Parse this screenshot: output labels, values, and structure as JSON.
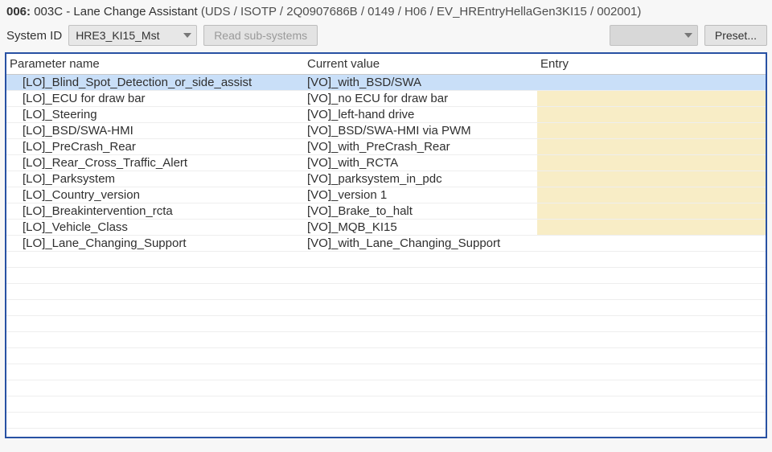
{
  "header": {
    "prefix": "006:",
    "title": "003C - Lane Change Assistant",
    "meta": "(UDS / ISOTP / 2Q0907686B / 0149 / H06 / EV_HREntryHellaGen3KI15 / 002001)"
  },
  "toolbar": {
    "system_label": "System ID",
    "system_value": "HRE3_KI15_Mst",
    "read_subsystems": "Read sub-systems",
    "dropdown2_value": "",
    "preset": "Preset..."
  },
  "columns": {
    "param": "Parameter name",
    "value": "Current value",
    "entry": "Entry"
  },
  "rows": [
    {
      "param": "[LO]_Blind_Spot_Detection_or_side_assist",
      "value": "[VO]_with_BSD/SWA",
      "entry": "",
      "selected": true,
      "entry_hl": false
    },
    {
      "param": "[LO]_ECU for draw bar",
      "value": "[VO]_no ECU for draw bar",
      "entry": "",
      "selected": false,
      "entry_hl": true
    },
    {
      "param": "[LO]_Steering",
      "value": "[VO]_left-hand drive",
      "entry": "",
      "selected": false,
      "entry_hl": true
    },
    {
      "param": "[LO]_BSD/SWA-HMI",
      "value": "[VO]_BSD/SWA-HMI via PWM",
      "entry": "",
      "selected": false,
      "entry_hl": true
    },
    {
      "param": "[LO]_PreCrash_Rear",
      "value": "[VO]_with_PreCrash_Rear",
      "entry": "",
      "selected": false,
      "entry_hl": true
    },
    {
      "param": "[LO]_Rear_Cross_Traffic_Alert",
      "value": "[VO]_with_RCTA",
      "entry": "",
      "selected": false,
      "entry_hl": true
    },
    {
      "param": "[LO]_Parksystem",
      "value": "[VO]_parksystem_in_pdc",
      "entry": "",
      "selected": false,
      "entry_hl": true
    },
    {
      "param": "[LO]_Country_version",
      "value": "[VO]_version 1",
      "entry": "",
      "selected": false,
      "entry_hl": true
    },
    {
      "param": "[LO]_Breakintervention_rcta",
      "value": "[VO]_Brake_to_halt",
      "entry": "",
      "selected": false,
      "entry_hl": true
    },
    {
      "param": "[LO]_Vehicle_Class",
      "value": "[VO]_MQB_KI15",
      "entry": "",
      "selected": false,
      "entry_hl": true
    },
    {
      "param": "[LO]_Lane_Changing_Support",
      "value": "[VO]_with_Lane_Changing_Support",
      "entry": "",
      "selected": false,
      "entry_hl": false
    }
  ],
  "empty_rows": 11
}
